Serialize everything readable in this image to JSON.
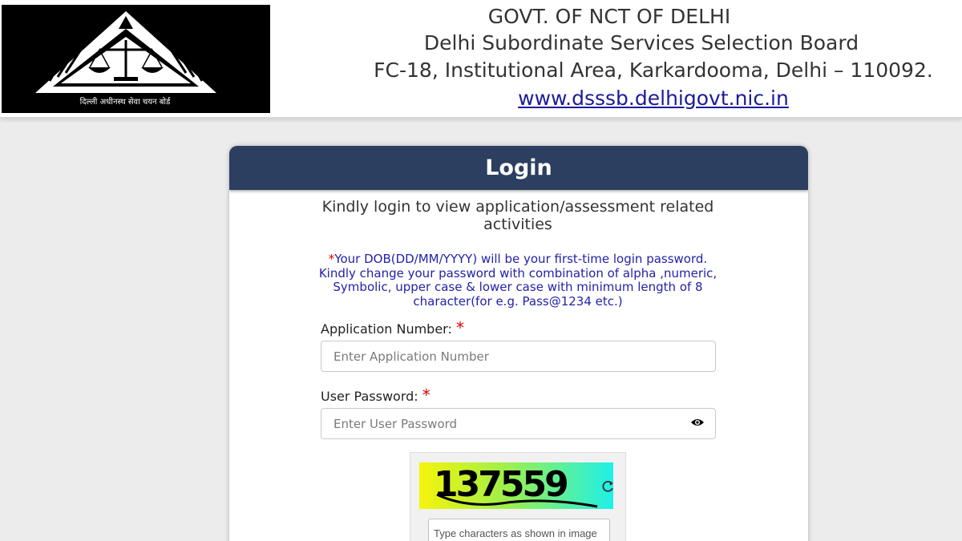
{
  "header": {
    "logo_hindi": "दिल्ली अधीनस्थ सेवा चयन बोर्ड",
    "line1": "GOVT. OF NCT OF DELHI",
    "line2": "Delhi Subordinate Services Selection Board",
    "line3": "FC-18, Institutional Area, Karkardooma, Delhi – 110092.",
    "website": "www.dsssb.delhigovt.nic.in"
  },
  "login": {
    "title": "Login",
    "subtitle": "Kindly login to view application/assessment related activities",
    "notice_star": "*",
    "notice": "Your DOB(DD/MM/YYYY) will be your first-time login password. Kindly change your password with combination of alpha ,numeric, Symbolic, upper case & lower case with minimum length of 8 character(for e.g. Pass@1234 etc.)",
    "application_label": "Application Number:",
    "application_placeholder": "Enter Application Number",
    "password_label": "User Password:",
    "password_placeholder": "Enter User Password",
    "required_mark": "*",
    "captcha_code": "137559",
    "captcha_placeholder": "Type characters as shown in image"
  },
  "colors": {
    "header_bar": "#2c3f61",
    "notice_text": "#2222aa",
    "required": "#e00000",
    "link": "#1b1b9c"
  },
  "icons": [
    "scales-of-justice-icon",
    "eye-icon",
    "refresh-icon"
  ]
}
